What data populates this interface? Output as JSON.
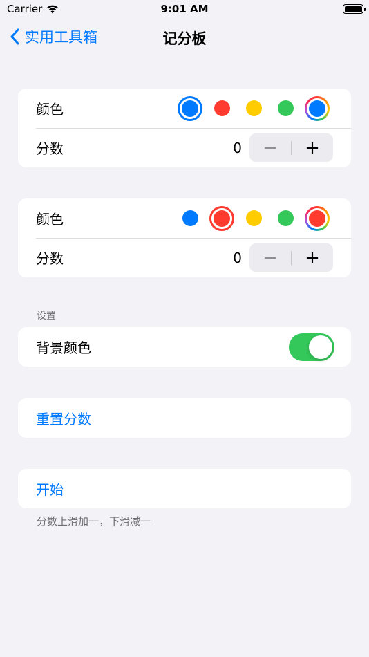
{
  "status_bar": {
    "carrier": "Carrier",
    "time": "9:01 AM"
  },
  "nav": {
    "back_label": "实用工具箱",
    "title": "记分板"
  },
  "player1": {
    "color_label": "颜色",
    "score_label": "分数",
    "score": "0",
    "selected_color": "blue"
  },
  "player2": {
    "color_label": "颜色",
    "score_label": "分数",
    "score": "0",
    "selected_color": "red"
  },
  "colors": {
    "blue": "#007aff",
    "red": "#ff3b30",
    "yellow": "#ffcc00",
    "green": "#34c759"
  },
  "settings": {
    "header": "设置",
    "background_color_label": "背景颜色",
    "background_color_on": true
  },
  "reset_label": "重置分数",
  "start_label": "开始",
  "footer_hint": "分数上滑加一，下滑减一",
  "stepper": {
    "minus": "−",
    "plus": "+"
  }
}
